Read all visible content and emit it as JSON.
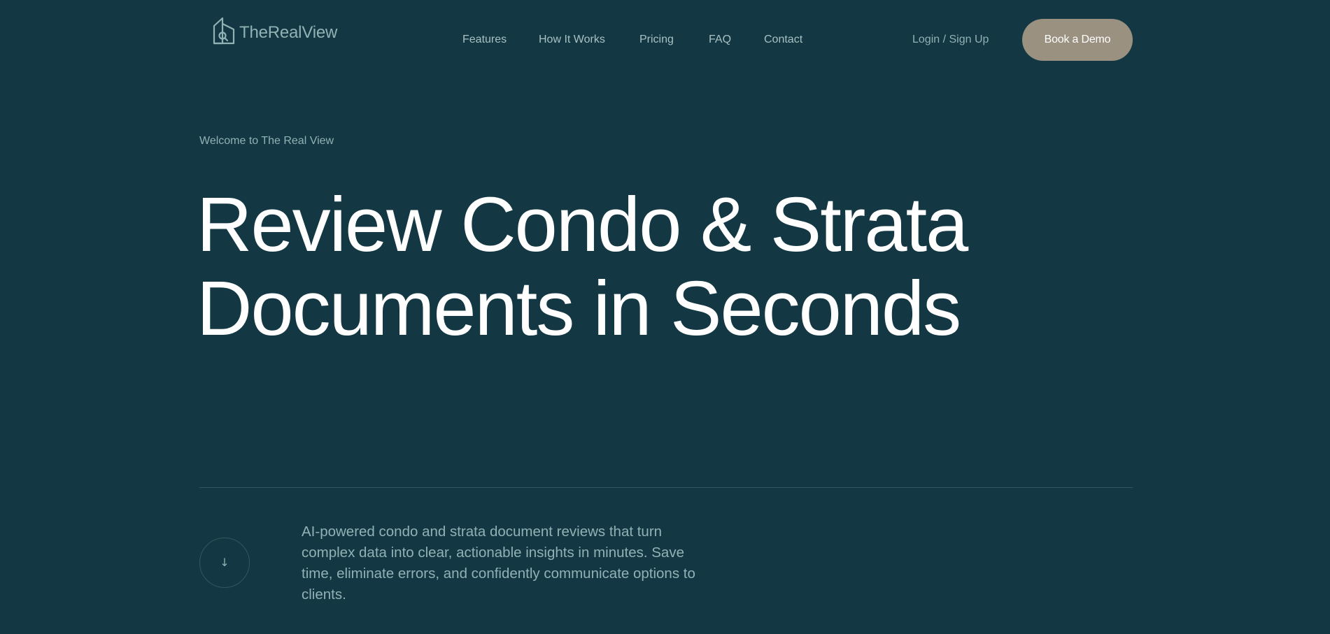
{
  "header": {
    "logo_text": "TheRealView",
    "nav": [
      {
        "label": "Features"
      },
      {
        "label": "How It Works"
      },
      {
        "label": "Pricing"
      },
      {
        "label": "FAQ"
      },
      {
        "label": "Contact"
      }
    ],
    "login_label": "Login / Sign Up",
    "demo_label": "Book a Demo"
  },
  "hero": {
    "eyebrow": "Welcome to The Real View",
    "title_line1": "Review Condo & Strata",
    "title_line2": "Documents in Seconds",
    "scroll_icon": "↓",
    "description": "AI-powered condo and strata document reviews that turn complex data into clear, actionable insights in minutes. Save time, eliminate errors, and confidently communicate options to clients."
  },
  "icons": {
    "logo": "house-magnifier-icon",
    "scroll": "arrow-down-icon"
  },
  "colors": {
    "background": "#143843",
    "accent_button": "#9b9181",
    "muted_text": "#8fb2b4",
    "heading_text": "#ffffff",
    "divider": "#2f5860"
  }
}
